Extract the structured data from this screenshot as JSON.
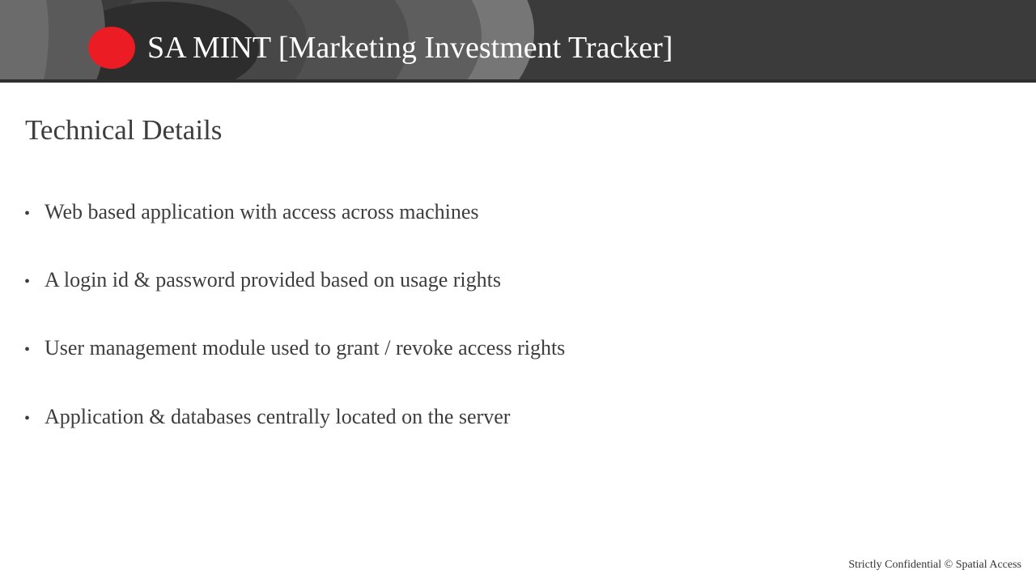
{
  "header": {
    "title": "SA MINT [Marketing Investment Tracker]",
    "brand_color": "#ec1c24",
    "logo_icon": "red-circle-logo"
  },
  "main": {
    "section_title": "Technical Details",
    "bullets": [
      "Web based application with access across machines",
      "A login id & password provided based on usage rights",
      "User management module used to grant / revoke access rights",
      "Application & databases centrally located on the server"
    ],
    "bullet_glyph": "•"
  },
  "footer": {
    "text": "Strictly Confidential © Spatial Access"
  }
}
